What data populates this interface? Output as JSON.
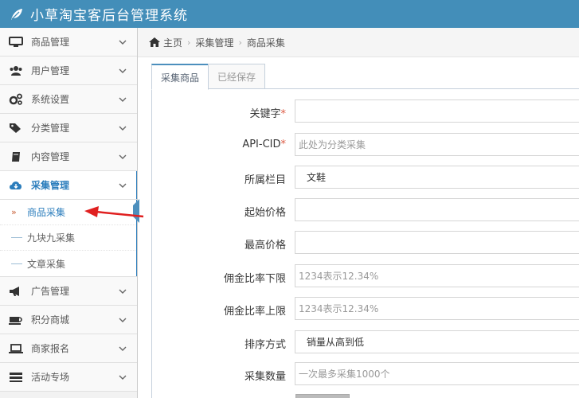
{
  "header": {
    "title": "小草淘宝客后台管理系统",
    "logo_icon": "leaf-icon",
    "bg_color": "#438eb9"
  },
  "sidebar": {
    "items": [
      {
        "label": "商品管理",
        "icon": "desktop-icon"
      },
      {
        "label": "用户管理",
        "icon": "users-icon"
      },
      {
        "label": "系统设置",
        "icon": "gears-icon"
      },
      {
        "label": "分类管理",
        "icon": "tags-icon"
      },
      {
        "label": "内容管理",
        "icon": "book-icon"
      },
      {
        "label": "采集管理",
        "icon": "cloud-download-icon",
        "active": true
      }
    ],
    "submenu": [
      {
        "label": "商品采集",
        "active": true
      },
      {
        "label": "九块九采集"
      },
      {
        "label": "文章采集"
      }
    ],
    "items_after": [
      {
        "label": "广告管理",
        "icon": "bullhorn-icon"
      },
      {
        "label": "积分商城",
        "icon": "coffee-icon"
      },
      {
        "label": "商家报名",
        "icon": "laptop-icon"
      },
      {
        "label": "活动专场",
        "icon": "list-icon"
      }
    ]
  },
  "breadcrumb": {
    "home": "主页",
    "section": "采集管理",
    "current": "商品采集"
  },
  "tabs": [
    {
      "label": "采集商品",
      "active": true
    },
    {
      "label": "已经保存"
    }
  ],
  "form": {
    "keyword": {
      "label": "关键字",
      "required": "*",
      "value": ""
    },
    "api_cid": {
      "label": "API-CID",
      "required": "*",
      "placeholder": "此处为分类采集"
    },
    "category": {
      "label": "所属栏目",
      "value": "文鞋"
    },
    "start_price": {
      "label": "起始价格",
      "value": ""
    },
    "max_price": {
      "label": "最高价格",
      "value": ""
    },
    "commission_min": {
      "label": "佣金比率下限",
      "placeholder": "1234表示12.34%"
    },
    "commission_max": {
      "label": "佣金比率上限",
      "placeholder": "1234表示12.34%"
    },
    "sort": {
      "label": "排序方式",
      "value": "销量从高到低"
    },
    "count": {
      "label": "采集数量",
      "placeholder": "一次最多采集1000个"
    }
  },
  "colors": {
    "accent": "#2b7dbc",
    "annotation_arrow": "#e02020"
  }
}
